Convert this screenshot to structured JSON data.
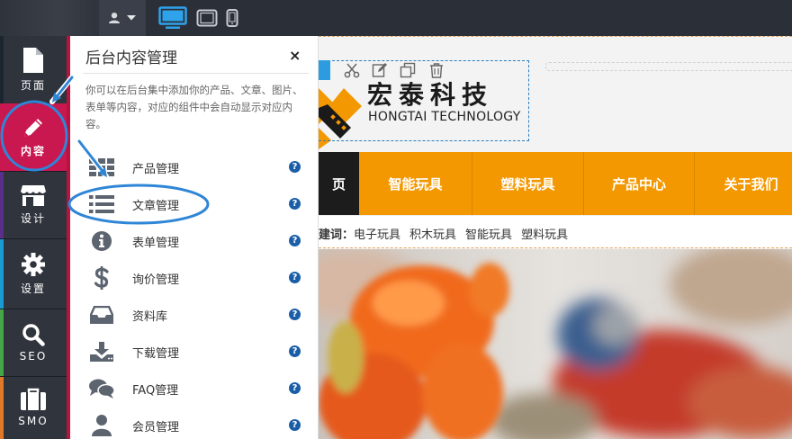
{
  "topbar": {
    "icons": [
      "user-icon",
      "caret-down-icon",
      "desktop-icon",
      "tablet-icon",
      "phone-icon"
    ]
  },
  "leftnav": {
    "items": [
      {
        "label": "页面",
        "icon": "page-icon",
        "color": "#2f333c"
      },
      {
        "label": "内容",
        "icon": "pencil-icon",
        "color": "#c9174f"
      },
      {
        "label": "设计",
        "icon": "store-icon",
        "color": "#30343d"
      },
      {
        "label": "设置",
        "icon": "gear-icon",
        "color": "#30343d"
      },
      {
        "label": "SEO",
        "icon": "search-icon",
        "color": "#30343d"
      },
      {
        "label": "SMO",
        "icon": "briefcase-icon",
        "color": "#30343d"
      }
    ]
  },
  "panel": {
    "title": "后台内容管理",
    "close": "×",
    "description": "你可以在后台集中添加你的产品、文章、图片、表单等内容，对应的组件中会自动显示对应内容。",
    "items": [
      {
        "label": "产品管理",
        "icon": "grid-icon"
      },
      {
        "label": "文章管理",
        "icon": "list-icon"
      },
      {
        "label": "表单管理",
        "icon": "info-icon"
      },
      {
        "label": "询价管理",
        "icon": "dollar-icon"
      },
      {
        "label": "资料库",
        "icon": "inbox-icon"
      },
      {
        "label": "下载管理",
        "icon": "download-icon"
      },
      {
        "label": "FAQ管理",
        "icon": "chat-icon"
      },
      {
        "label": "会员管理",
        "icon": "member-icon"
      }
    ],
    "help": "?"
  },
  "site": {
    "logo_cn": "宏泰科技",
    "logo_en": "HONGTAI TECHNOLOGY",
    "nav": [
      "页",
      "智能玩具",
      "塑料玩具",
      "产品中心",
      "关于我们"
    ],
    "keyword_label": "建词：",
    "keywords": [
      "电子玩具",
      "积木玩具",
      "智能玩具",
      "塑料玩具"
    ],
    "accent_color": "#f39800"
  }
}
